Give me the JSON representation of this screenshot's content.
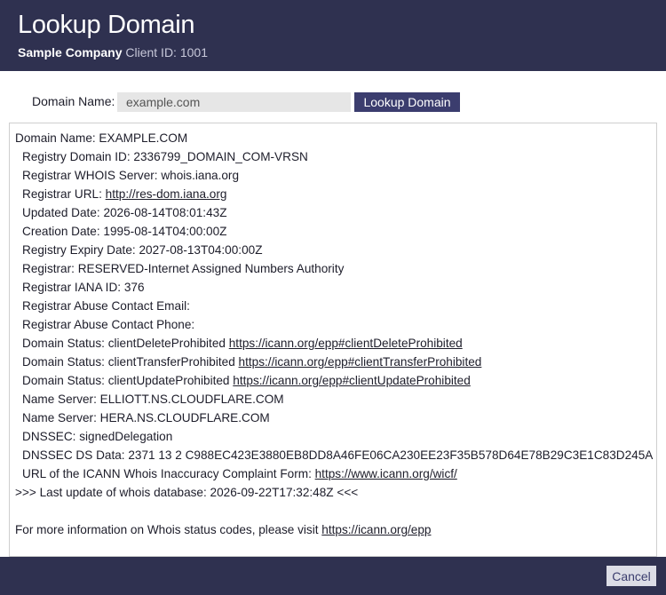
{
  "header": {
    "title": "Lookup Domain",
    "company": "Sample Company",
    "client_id": "Client ID: 1001"
  },
  "lookup": {
    "label": "Domain Name:",
    "value": "example.com",
    "button_label": "Lookup Domain"
  },
  "whois": {
    "domain_name": "Domain Name: EXAMPLE.COM",
    "registry_domain_id": "Registry Domain ID: 2336799_DOMAIN_COM-VRSN",
    "registrar_whois_server": "Registrar WHOIS Server: whois.iana.org",
    "registrar_url_label": "Registrar URL: ",
    "registrar_url": "http://res-dom.iana.org",
    "updated_date": "Updated Date: 2026-08-14T08:01:43Z",
    "creation_date": "Creation Date: 1995-08-14T04:00:00Z",
    "expiry_date": "Registry Expiry Date: 2027-08-13T04:00:00Z",
    "registrar": "Registrar: RESERVED-Internet Assigned Numbers Authority",
    "iana_id": "Registrar IANA ID: 376",
    "abuse_email": "Registrar Abuse Contact Email:",
    "abuse_phone": "Registrar Abuse Contact Phone:",
    "status": [
      {
        "label": "Domain Status: clientDeleteProhibited ",
        "link": "https://icann.org/epp#clientDeleteProhibited"
      },
      {
        "label": "Domain Status: clientTransferProhibited ",
        "link": "https://icann.org/epp#clientTransferProhibited"
      },
      {
        "label": "Domain Status: clientUpdateProhibited ",
        "link": "https://icann.org/epp#clientUpdateProhibited"
      }
    ],
    "name_server_1": "Name Server: ELLIOTT.NS.CLOUDFLARE.COM",
    "name_server_2": "Name Server: HERA.NS.CLOUDFLARE.COM",
    "dnssec": "DNSSEC: signedDelegation",
    "dnssec_ds": "DNSSEC DS Data: 2371 13 2 C988EC423E3880EB8DD8A46FE06CA230EE23F35B578D64E78B29C3E1C83D245A",
    "complaint_label": "URL of the ICANN Whois Inaccuracy Complaint Form: ",
    "complaint_link": "https://www.icann.org/wicf/",
    "last_update": ">>> Last update of whois database: 2026-09-22T17:32:48Z <<<",
    "more_info_label": "For more information on Whois status codes, please visit ",
    "more_info_link": "https://icann.org/epp"
  },
  "footer": {
    "cancel_label": "Cancel"
  }
}
